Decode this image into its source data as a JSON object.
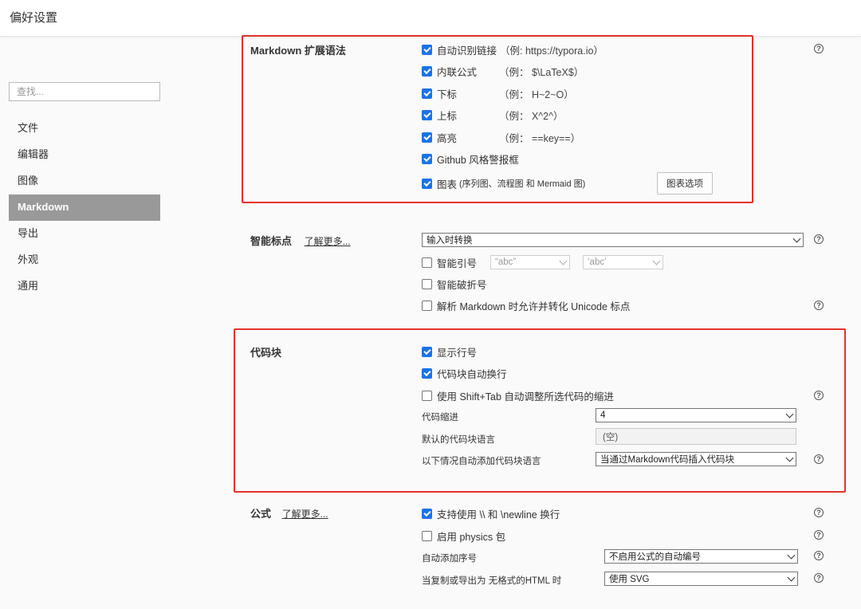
{
  "window": {
    "title": "偏好设置"
  },
  "sidebar": {
    "search_placeholder": "查找...",
    "items": [
      {
        "label": "文件"
      },
      {
        "label": "编辑器"
      },
      {
        "label": "图像"
      },
      {
        "label": "Markdown",
        "active": true
      },
      {
        "label": "导出"
      },
      {
        "label": "外观"
      },
      {
        "label": "通用"
      }
    ]
  },
  "markdown_ext": {
    "title": "Markdown 扩展语法",
    "options": [
      {
        "label": "自动识别链接",
        "example": "（例: https://typora.io）",
        "checked": true
      },
      {
        "label": "内联公式",
        "example": "（例：  $\\LaTeX$）",
        "checked": true
      },
      {
        "label": "下标",
        "example": "（例：  H~2~O）",
        "checked": true
      },
      {
        "label": "上标",
        "example": "（例：  X^2^）",
        "checked": true
      },
      {
        "label": "高亮",
        "example": "（例：  ==key==）",
        "checked": true
      },
      {
        "label": "Github 风格警报框",
        "checked": true
      },
      {
        "label": "图表",
        "sub": "(序列图、流程图 和 Mermaid 图)",
        "checked": true
      }
    ],
    "diagram_options_button": "图表选项"
  },
  "smart_punct": {
    "title": "智能标点",
    "learn_more": "了解更多...",
    "mode": "输入时转换",
    "smart_quotes_label": "智能引号",
    "smart_quotes_checked": false,
    "double_quote_value": "“abc”",
    "single_quote_value": "‘abc’",
    "smart_dash_label": "智能破折号",
    "smart_dash_checked": false,
    "unicode_label": "解析 Markdown 时允许并转化 Unicode 标点",
    "unicode_checked": false
  },
  "code_block": {
    "title": "代码块",
    "show_line_numbers": {
      "label": "显示行号",
      "checked": true
    },
    "auto_wrap": {
      "label": "代码块自动换行",
      "checked": true
    },
    "shift_tab": {
      "label": "使用 Shift+Tab 自动调整所选代码的缩进",
      "checked": false
    },
    "indent_label": "代码缩进",
    "indent_value": "4",
    "default_lang_label": "默认的代码块语言",
    "default_lang_value": "(空)",
    "auto_lang_label": "以下情况自动添加代码块语言",
    "auto_lang_value": "当通过Markdown代码插入代码块"
  },
  "math": {
    "title": "公式",
    "learn_more": "了解更多...",
    "newline": {
      "label": "支持使用 \\\\ 和 \\newline 换行",
      "checked": true
    },
    "physics": {
      "label": "启用 physics 包",
      "checked": false
    },
    "auto_number_label": "自动添加序号",
    "auto_number_value": "不启用公式的自动编号",
    "export_label": "当复制或导出为 无格式的HTML 时",
    "export_value": "使用 SVG"
  },
  "icons": {
    "help": "question-circle-icon",
    "check": "checkmark-icon",
    "dropdown": "chevron-down-icon"
  },
  "colors": {
    "accent": "#1a73e8",
    "highlight_box": "#e4322b",
    "sidebar_active": "#999999"
  }
}
